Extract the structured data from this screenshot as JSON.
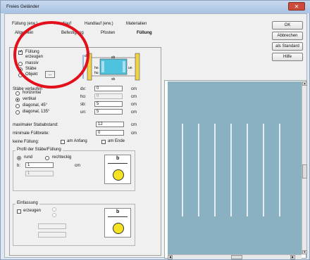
{
  "window": {
    "title": "Freies Geländer",
    "close": "✕"
  },
  "tabs": [
    "Füllung (erw.)",
    "Handlauf",
    "Handlauf (erw.)",
    "Materialien",
    "Allgemein",
    "Befestigung",
    "Pfosten",
    "Füllung"
  ],
  "fill": {
    "erzeugen_label": "Füllung erzeugen",
    "erzeugen_line1": "Füllung",
    "erzeugen_line2": "erzeugen",
    "options": [
      "massiv",
      "Stäbe",
      "Objekt"
    ],
    "selected": "Stäbe",
    "object_btn": "..."
  },
  "stab": {
    "section": "Stäbe verlaufen",
    "horiz": "horizontal",
    "vert": "vertikal",
    "diag45": "diagonal, 45°",
    "diag135": "diagonal, 135°",
    "fields": [
      {
        "label": "dx:",
        "value": "0",
        "unit": "cm"
      },
      {
        "label": "ho:",
        "value": "0",
        "unit": "cm"
      },
      {
        "label": "sb:",
        "value": "5",
        "unit": "cm"
      },
      {
        "label": "un:",
        "value": "5",
        "unit": "cm"
      }
    ],
    "max_label": "maximaler Stababstand:",
    "max_value": "12",
    "max_unit": "cm",
    "min_label": "minimale Füllbreite:",
    "min_value": "0",
    "min_unit": "cm",
    "keine_label": "keine Füllung:",
    "anfang": "am Anfang",
    "ende": "am Ende"
  },
  "profil": {
    "title": "Profil der Stäbe/Füllung",
    "rund": "rund",
    "rechteck": "rechteckig",
    "b_label": "b:",
    "b_value": "1",
    "b_unit": "cm",
    "h_value": "1",
    "b_marker": "b"
  },
  "einfassung": {
    "title": "Einfassung",
    "erzeugen": "erzeugen",
    "marker": "b"
  },
  "diagram": {
    "dx": "dx",
    "ho": "ho",
    "un": "un",
    "sb": "sb",
    "sb2": "sb",
    "hu": "hu"
  },
  "buttons": {
    "ok": "OK",
    "cancel": "Abbrechen",
    "standard": "als Standard",
    "help": "Hilfe"
  },
  "colors": {
    "preview_bg": "#8ab1c1",
    "highlight": "#e3101c",
    "diagram_fill": "#4fc3de"
  }
}
